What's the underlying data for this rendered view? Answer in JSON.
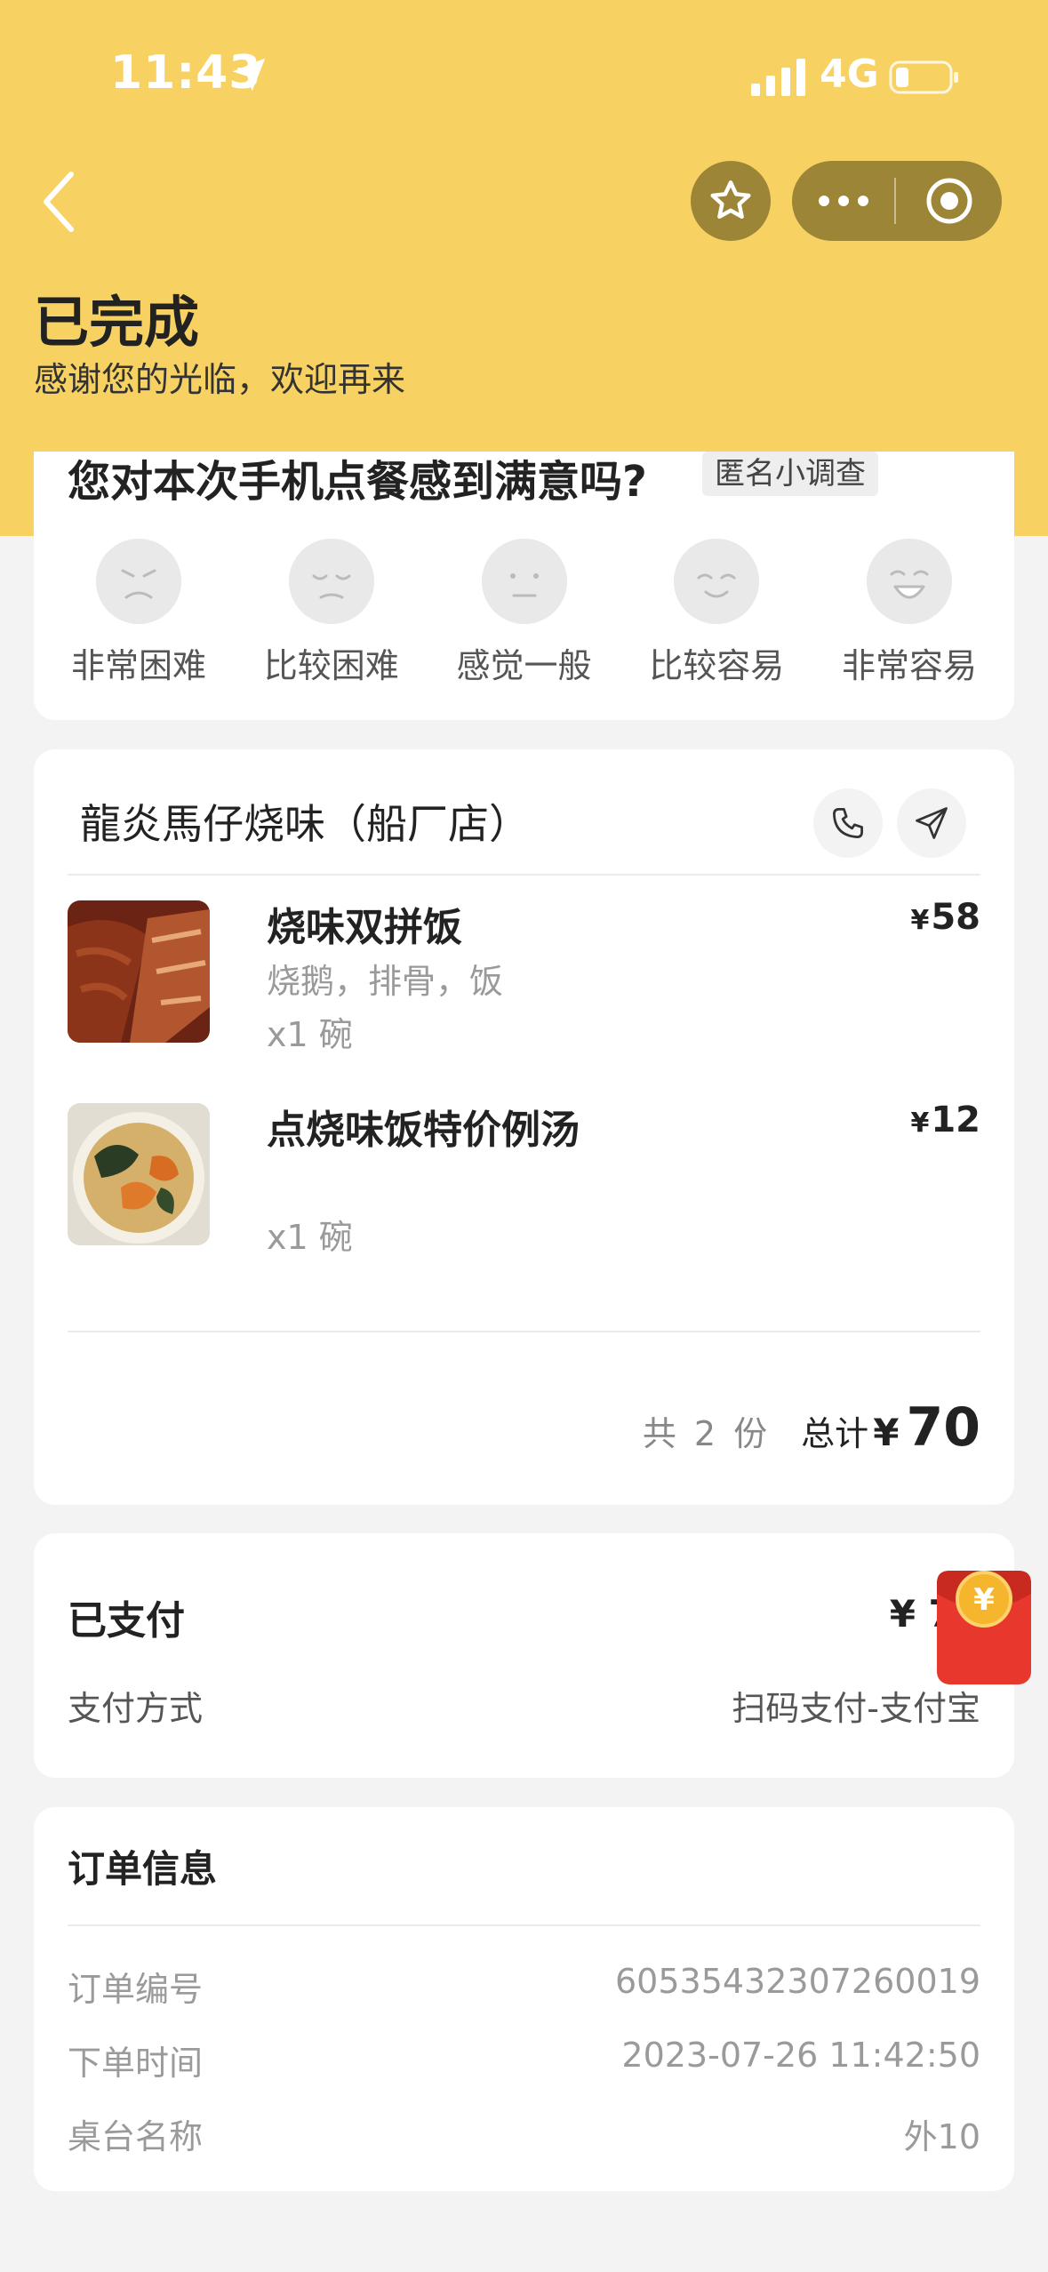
{
  "status_bar": {
    "time": "11:43",
    "network": "4G"
  },
  "header": {
    "status_title": "已完成",
    "status_subtitle": "感谢您的光临，欢迎再来"
  },
  "survey": {
    "question": "您对本次手机点餐感到满意吗?",
    "badge": "匿名小调查",
    "options": [
      {
        "label": "非常困难",
        "face": "angry-face-icon"
      },
      {
        "label": "比较困难",
        "face": "sad-face-icon"
      },
      {
        "label": "感觉一般",
        "face": "neutral-face-icon"
      },
      {
        "label": "比较容易",
        "face": "smile-face-icon"
      },
      {
        "label": "非常容易",
        "face": "laugh-face-icon"
      }
    ]
  },
  "order": {
    "shop_name": "龍炎馬仔烧味（船厂店）",
    "items": [
      {
        "name": "烧味双拼饭",
        "desc": "烧鹅，排骨，饭",
        "qty": "x1 碗",
        "currency": "¥",
        "price": "58"
      },
      {
        "name": "点烧味饭特价例汤",
        "desc": "",
        "qty": "x1 碗",
        "currency": "¥",
        "price": "12"
      }
    ],
    "count_text": "共 2 份",
    "total_label": "总计",
    "total_currency": "¥",
    "total_value": "70"
  },
  "payment": {
    "paid_label": "已支付",
    "paid_amount": "¥ 70",
    "method_label": "支付方式",
    "method_value": "扫码支付-支付宝"
  },
  "order_info": {
    "title": "订单信息",
    "rows": [
      {
        "label": "订单编号",
        "value": "60535432307260019"
      },
      {
        "label": "下单时间",
        "value": "2023-07-26 11:42:50"
      },
      {
        "label": "桌台名称",
        "value": "外10"
      }
    ]
  },
  "colors": {
    "header": "#f7d263",
    "nav_button": "#9c8536",
    "red_packet": "#e8372c"
  }
}
